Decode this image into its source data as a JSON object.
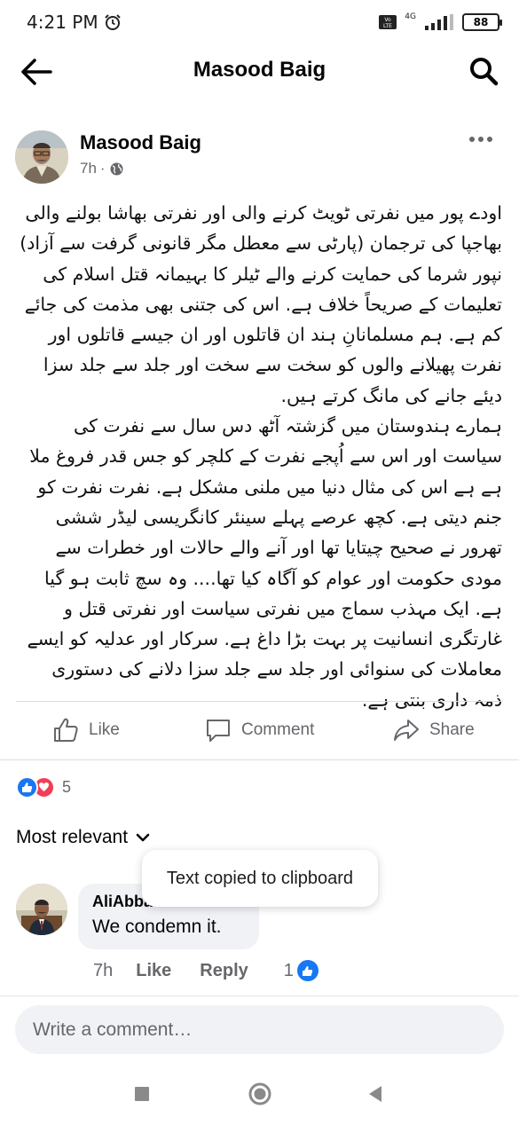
{
  "status_bar": {
    "time": "4:21 PM",
    "network": "4G",
    "battery": "88"
  },
  "header": {
    "title": "Masood Baig"
  },
  "post": {
    "author": "Masood Baig",
    "time": "7h",
    "separator": "·",
    "text": "اودے پور میں نفرتی ٹویٹ کرنے والی اور نفرتی بھاشا بولنے والی بھاجپا کی ترجمان (پارٹی سے معطل مگر قانونی گرفت سے آزاد) نپور شرما کی حمایت کرنے والے ٹیلر کا بہیمانہ قتل اسلام کی تعلیمات کے صریحاً خلاف ہے. اس کی جتنی بھی مذمت کی جائے کم ہے. ہم مسلمانانِ ہند ان قاتلوں اور ان جیسے قاتلوں اور نفرت پھیلانے والوں کو سخت سے سخت اور جلد سے جلد سزا دیئے جانے کی مانگ کرتے ہیں.\nہمارے ہندوستان میں گزشتہ آٹھ دس سال سے نفرت کی سیاست اور اس سے اُپجے نفرت کے کلچر کو جس قدر فروغ ملا ہے ہے اس کی مثال دنیا میں ملنی مشکل ہے. نفرت نفرت کو جنم دیتی ہے. کچھ عرصے پہلے سینئر کانگریسی لیڈر ششی تھرور نے صحیح چیتایا تھا اور آنے والے حالات اور خطرات سے مودی حکومت اور عوام کو آگاہ کیا تھا.... وہ سچ ثابت ہو گیا ہے. ایک مہذب سماج میں نفرتی سیاست اور نفرتی قتل و غارتگری انسانیت پر بہت بڑا داغ ہے. سرکار اور عدلیہ کو ایسے معاملات کی سنوائی اور جلد سے جلد سزا دلانے کی دستوری ذمہ داری بنتی ہے."
  },
  "actions": {
    "like": "Like",
    "comment": "Comment",
    "share": "Share"
  },
  "reactions": {
    "count": "5"
  },
  "sort": {
    "label": "Most relevant"
  },
  "comment": {
    "author": "AliAbbas Ummid",
    "text": "We condemn it.",
    "time": "7h",
    "like": "Like",
    "reply": "Reply",
    "reaction_count": "1"
  },
  "toast": {
    "text": "Text copied to clipboard"
  },
  "compose": {
    "placeholder": "Write a comment…"
  },
  "colors": {
    "facebook_blue": "#1877f2",
    "love_red": "#f33e58",
    "secondary_text": "#65676b",
    "bubble_bg": "#f0f2f5"
  }
}
